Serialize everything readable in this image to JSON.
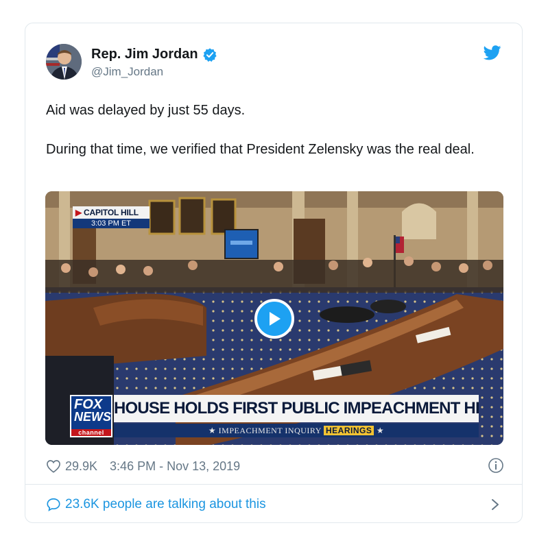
{
  "tweet": {
    "author": {
      "display_name": "Rep. Jim Jordan",
      "handle": "@Jim_Jordan",
      "verified": true,
      "avatar_icon": "avatar-photo"
    },
    "platform_icon": "twitter-bird-icon",
    "text_paragraphs": [
      "Aid was delayed by just 55 days.",
      "During that time, we verified that President Zelensky was the real deal."
    ],
    "video": {
      "location_label": "CAPITOL HILL",
      "time_label": "3:03 PM ET",
      "network_logo_lines": [
        "FOX",
        "NEWS",
        "channel"
      ],
      "headline": "HOUSE HOLDS FIRST PUBLIC IMPEACHMENT HEARING",
      "ticker_prefix": "★ IMPEACHMENT INQUIRY",
      "ticker_highlight": "HEARINGS",
      "ticker_suffix": "★",
      "play_icon": "play-icon"
    },
    "likes": "29.9K",
    "timestamp": "3:46 PM - Nov 13, 2019",
    "conversation": "23.6K people are talking about this"
  },
  "colors": {
    "accent": "#1da1f2",
    "link": "#1b95e0",
    "muted": "#657786",
    "border": "#e1e8ed"
  }
}
